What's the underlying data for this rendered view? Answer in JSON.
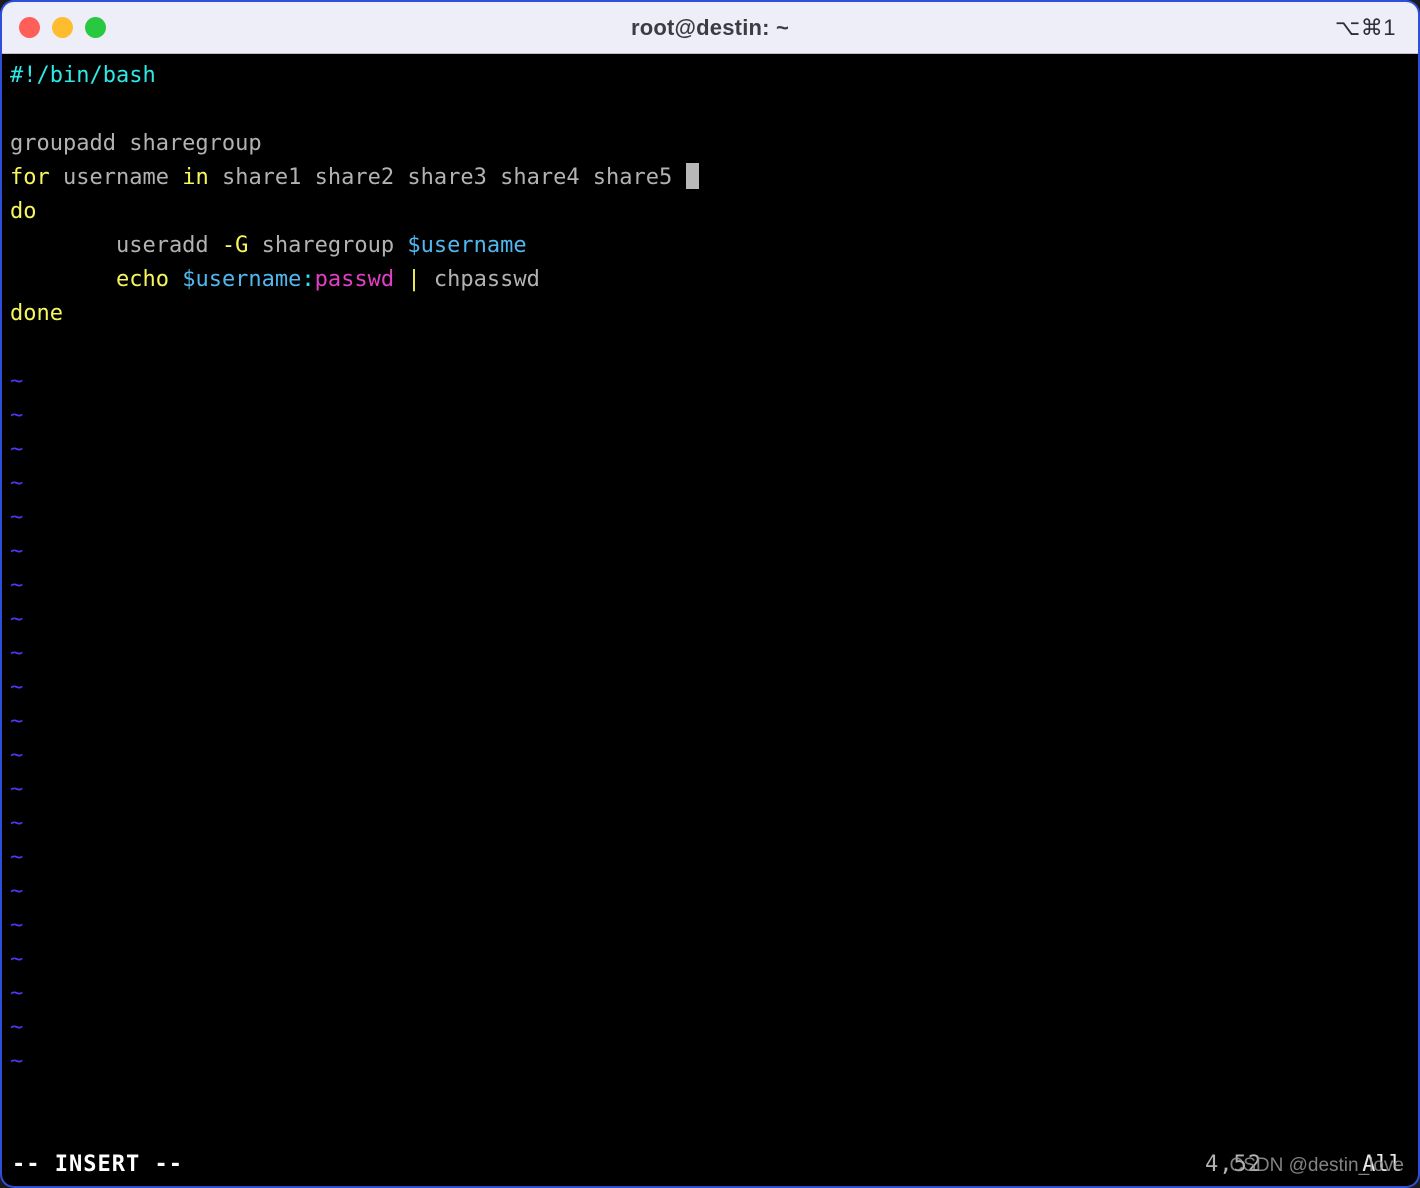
{
  "window": {
    "title": "root@destin: ~",
    "shortcut_hint": "⌥⌘1",
    "traffic_lights": [
      {
        "name": "close",
        "color": "#ff5f57"
      },
      {
        "name": "minimize",
        "color": "#febc2e"
      },
      {
        "name": "zoom",
        "color": "#28c840"
      }
    ]
  },
  "editor": {
    "filetype": "bash",
    "lines": [
      {
        "n": 1,
        "segments": [
          {
            "text": "#!/bin/bash",
            "style": "comment"
          }
        ]
      },
      {
        "n": 2,
        "segments": []
      },
      {
        "n": 3,
        "segments": [
          {
            "text": "groupadd sharegroup",
            "style": "plain"
          }
        ]
      },
      {
        "n": 4,
        "segments": [
          {
            "text": "for",
            "style": "kw"
          },
          {
            "text": " username ",
            "style": "plain"
          },
          {
            "text": "in",
            "style": "kw"
          },
          {
            "text": " share1 share2 share3 share4 share5 ",
            "style": "plain"
          },
          {
            "text": "",
            "style": "cursor"
          }
        ]
      },
      {
        "n": 5,
        "segments": [
          {
            "text": "do",
            "style": "kw"
          }
        ]
      },
      {
        "n": 6,
        "segments": [
          {
            "text": "        useradd ",
            "style": "plain"
          },
          {
            "text": "-G",
            "style": "kw"
          },
          {
            "text": " sharegroup ",
            "style": "plain"
          },
          {
            "text": "$username",
            "style": "var"
          }
        ]
      },
      {
        "n": 7,
        "segments": [
          {
            "text": "        ",
            "style": "plain"
          },
          {
            "text": "echo",
            "style": "kw"
          },
          {
            "text": " ",
            "style": "plain"
          },
          {
            "text": "$username",
            "style": "var"
          },
          {
            "text": ":",
            "style": "comment"
          },
          {
            "text": "passwd",
            "style": "str"
          },
          {
            "text": " ",
            "style": "plain"
          },
          {
            "text": "|",
            "style": "pipe"
          },
          {
            "text": " chpasswd",
            "style": "plain"
          }
        ]
      },
      {
        "n": 8,
        "segments": [
          {
            "text": "done",
            "style": "kw"
          }
        ]
      }
    ],
    "empty_marker": "~",
    "empty_marker_count": 21,
    "blank_lines_before_markers": 1
  },
  "statusbar": {
    "mode": "-- INSERT --",
    "position": "4,52",
    "scroll": "All"
  },
  "watermark": {
    "text": "CSDN @destin_love"
  },
  "colors": {
    "background": "#000000",
    "titlebar": "#edeef7",
    "title_text": "#3c3c45",
    "comment": "#2ee8e8",
    "plain": "#b2b2b2",
    "keyword": "#f6f65e",
    "variable": "#4fb8f0",
    "string": "#e23fc4",
    "tilde": "#4b3bf0",
    "cursor": "#b8b8b8",
    "window_edge": "#2f4fd8"
  }
}
